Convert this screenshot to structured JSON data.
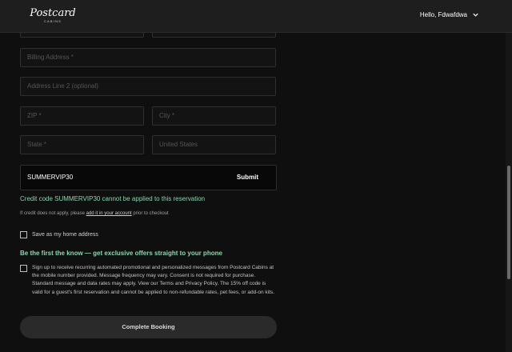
{
  "header": {
    "logo_main": "Postcard",
    "logo_sub": "CABINS",
    "greeting": "Hello, Fdwafdwa"
  },
  "form": {
    "billing_address_placeholder": "Billing Address *",
    "address_line2_placeholder": "Address Line 2 (optional)",
    "zip_placeholder": "ZIP *",
    "city_placeholder": "City *",
    "state_placeholder": "State *",
    "country_value": "United States"
  },
  "promo": {
    "code_value": "SUMMERVIP30",
    "submit_label": "Submit",
    "error_message": "Credit code SUMMERVIP30 cannot be applied to this reservation",
    "note_prefix": "If credit does not apply, please",
    "note_link": "add it in your account",
    "note_suffix": "prior to checkout"
  },
  "save_home": {
    "label": "Save as my home address"
  },
  "sms": {
    "headline": "Be the first the know — get exclusive offers straight to your phone",
    "consent": "Sign up to receive recurring automated promotional and personalized messages from Postcard Cabins at the mobile number provided. Message frequency may vary. Consent is not required for purchase. Standard message and data rates may apply. View our Terms and Privacy Policy. The 15% off code is valid for a guest's first reservation and cannot be applied to non-refundable rates, pet fees, or add-on kits."
  },
  "complete_button": "Complete Booking",
  "colors": {
    "accent": "#8fd4b2",
    "background": "#0f0f0f",
    "header": "#1e1e1e"
  },
  "icons": {
    "user_menu": "chevron-down-icon"
  }
}
